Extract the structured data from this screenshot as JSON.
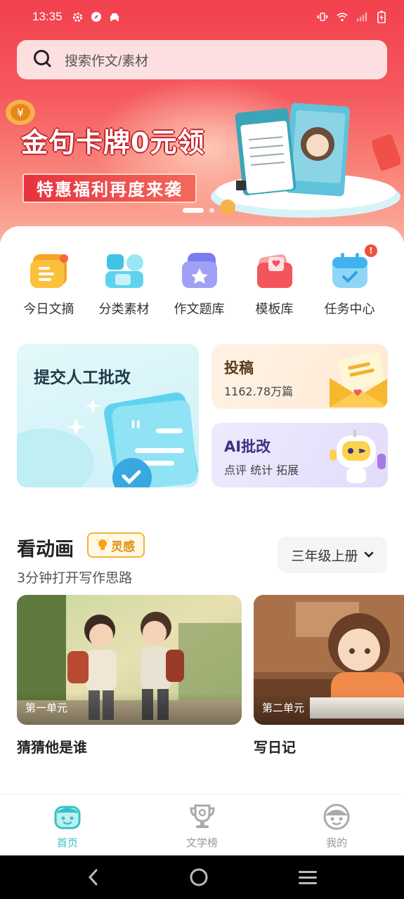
{
  "status_bar": {
    "time": "13:35"
  },
  "search": {
    "placeholder": "搜索作文/素材"
  },
  "banner": {
    "title": "金句卡牌0元领",
    "subtitle": "特惠福利再度来袭"
  },
  "quick_menu": [
    {
      "label": "今日文摘",
      "icon": "daily-digest-icon",
      "color": "#f7a326"
    },
    {
      "label": "分类素材",
      "icon": "category-material-icon",
      "color": "#3fc4e6"
    },
    {
      "label": "作文题库",
      "icon": "essay-bank-icon",
      "color": "#7b7cf2"
    },
    {
      "label": "模板库",
      "icon": "template-library-icon",
      "color": "#f2555b"
    },
    {
      "label": "任务中心",
      "icon": "task-center-icon",
      "color": "#3fb3ef",
      "badge": "!"
    }
  ],
  "cards": {
    "manual": {
      "title": "提交人工批改"
    },
    "submit": {
      "title": "投稿",
      "subtitle": "1162.78万篇"
    },
    "ai": {
      "title": "AI批改",
      "subtitle": "点评 统计 拓展"
    }
  },
  "animation": {
    "title": "看动画",
    "tag": "灵感",
    "subtitle": "3分钟打开写作思路",
    "grade": "三年级上册",
    "videos": [
      {
        "unit": "第一单元",
        "title": "猜猜他是谁"
      },
      {
        "unit": "第二单元",
        "title": "写日记"
      }
    ]
  },
  "bottom_nav": [
    {
      "label": "首页",
      "active": true
    },
    {
      "label": "文学榜",
      "active": false
    },
    {
      "label": "我的",
      "active": false
    }
  ],
  "colors": {
    "accent": "#36c1c6",
    "banner_red": "#f2404d"
  }
}
